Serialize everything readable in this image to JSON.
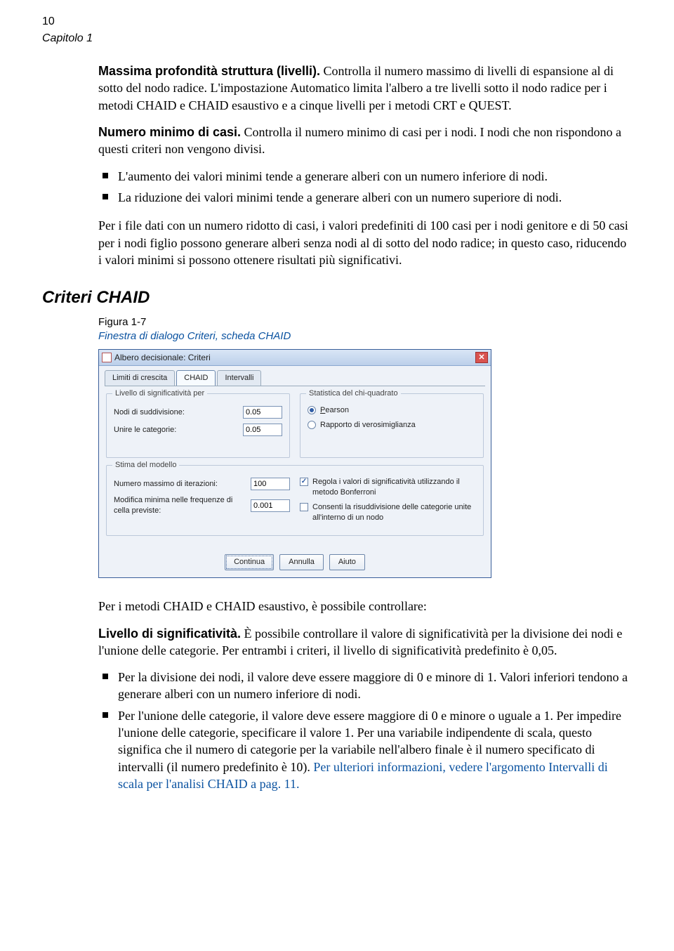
{
  "page": {
    "number": "10",
    "chapter": "Capitolo 1"
  },
  "para1": {
    "label": "Massima profondità struttura (livelli).",
    "text": " Controlla il numero massimo di livelli di espansione al di sotto del nodo radice. L'impostazione Automatico limita l'albero a tre livelli sotto il nodo radice per i metodi CHAID e CHAID esaustivo e a cinque livelli per i metodi CRT e QUEST."
  },
  "para2": {
    "label": "Numero minimo di casi.",
    "text": " Controlla il numero minimo di casi per i nodi. I nodi che non rispondono a questi criteri non vengono divisi."
  },
  "bullets1": [
    "L'aumento dei valori minimi tende a generare alberi con un numero inferiore di nodi.",
    "La riduzione dei valori minimi tende a generare alberi con un numero superiore di nodi."
  ],
  "para3": "Per i file dati con un numero ridotto di casi, i valori predefiniti di 100 casi per i nodi genitore e di 50 casi per i nodi figlio possono generare alberi senza nodi al di sotto del nodo radice; in questo caso, riducendo i valori minimi si possono ottenere risultati più significativi.",
  "section_heading": "Criteri CHAID",
  "figure": {
    "label": "Figura 1-7",
    "caption": "Finestra di dialogo Criteri, scheda CHAID"
  },
  "dialog": {
    "title": "Albero decisionale: Criteri",
    "tabs": [
      "Limiti di crescita",
      "CHAID",
      "Intervalli"
    ],
    "active_tab": "CHAID",
    "sig_group": {
      "legend": "Livello di significatività per",
      "split_label": "Nodi di suddivisione:",
      "split_value": "0.05",
      "merge_label": "Unire le categorie:",
      "merge_value": "0.05"
    },
    "chi_group": {
      "legend": "Statistica del chi-quadrato",
      "pearson_prefix": "P",
      "pearson_rest": "earson",
      "likelihood": "Rapporto di verosimiglianza"
    },
    "model_group": {
      "legend": "Stima del modello",
      "maxiter_label": "Numero massimo di iterazioni:",
      "maxiter_value": "100",
      "minchange_label": "Modifica minima nelle frequenze di cella previste:",
      "minchange_value": "0.001",
      "bonferroni": "Regola i valori di significatività utilizzando il metodo Bonferroni",
      "resplit": "Consenti la risuddivisione delle categorie unite all'interno di un nodo"
    },
    "buttons": {
      "continue": "Continua",
      "cancel": "Annulla",
      "help": "Aiuto"
    }
  },
  "para4": "Per i metodi CHAID e CHAID esaustivo, è possibile controllare:",
  "para5": {
    "label": "Livello di significatività.",
    "text": " È possibile controllare il valore di significatività per la divisione dei nodi e l'unione delle categorie. Per entrambi i criteri, il livello di significatività predefinito è 0,05."
  },
  "bullets2": [
    "Per la divisione dei nodi, il valore deve essere maggiore di 0 e minore di 1. Valori inferiori tendono a generare alberi con un numero inferiore di nodi.",
    "Per l'unione delle categorie, il valore deve essere maggiore di 0 e minore o uguale a 1. Per impedire l'unione delle categorie, specificare il valore 1. Per una variabile indipendente di scala, questo significa che il numero di categorie per la variabile nell'albero finale è il numero specificato di intervalli (il numero predefinito è 10). "
  ],
  "crossref": "Per ulteriori informazioni, vedere l'argomento Intervalli di scala per l'analisi CHAID a pag. 11."
}
